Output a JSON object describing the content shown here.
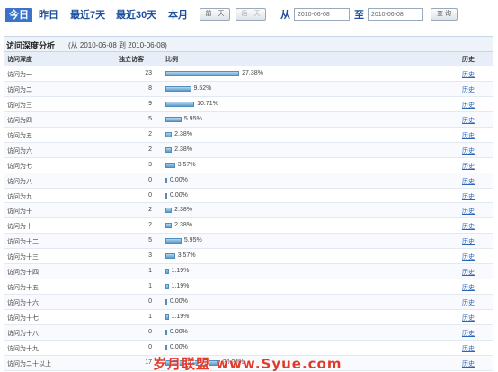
{
  "toolbar": {
    "tabs": [
      "今日",
      "昨日",
      "最近7天",
      "最近30天",
      "本月"
    ],
    "prev_label": "前一天",
    "next_label": "后一天",
    "from_label": "从",
    "from_value": "2010-06-08",
    "to_label": "至",
    "to_value": "2010-06-08",
    "query_label": "查 询"
  },
  "section": {
    "title": "访问深度分析",
    "range": "(从 2010-06-08 到 2010-06-08)"
  },
  "table": {
    "headers": {
      "depth": "访问深度",
      "count": "独立访客",
      "ratio": "比例",
      "history": "历史"
    },
    "rows": [
      {
        "name": "访问为一",
        "count": "23",
        "pct_label": "27.38%",
        "pct": 27.38,
        "history": "历史"
      },
      {
        "name": "访问为二",
        "count": "8",
        "pct_label": "9.52%",
        "pct": 9.52,
        "history": "历史"
      },
      {
        "name": "访问为三",
        "count": "9",
        "pct_label": "10.71%",
        "pct": 10.71,
        "history": "历史"
      },
      {
        "name": "访问为四",
        "count": "5",
        "pct_label": "5.95%",
        "pct": 5.95,
        "history": "历史"
      },
      {
        "name": "访问为五",
        "count": "2",
        "pct_label": "2.38%",
        "pct": 2.38,
        "history": "历史"
      },
      {
        "name": "访问为六",
        "count": "2",
        "pct_label": "2.38%",
        "pct": 2.38,
        "history": "历史"
      },
      {
        "name": "访问为七",
        "count": "3",
        "pct_label": "3.57%",
        "pct": 3.57,
        "history": "历史"
      },
      {
        "name": "访问为八",
        "count": "0",
        "pct_label": "0.00%",
        "pct": 0,
        "history": "历史"
      },
      {
        "name": "访问为九",
        "count": "0",
        "pct_label": "0.00%",
        "pct": 0,
        "history": "历史"
      },
      {
        "name": "访问为十",
        "count": "2",
        "pct_label": "2.38%",
        "pct": 2.38,
        "history": "历史"
      },
      {
        "name": "访问为十一",
        "count": "2",
        "pct_label": "2.38%",
        "pct": 2.38,
        "history": "历史"
      },
      {
        "name": "访问为十二",
        "count": "5",
        "pct_label": "5.95%",
        "pct": 5.95,
        "history": "历史"
      },
      {
        "name": "访问为十三",
        "count": "3",
        "pct_label": "3.57%",
        "pct": 3.57,
        "history": "历史"
      },
      {
        "name": "访问为十四",
        "count": "1",
        "pct_label": "1.19%",
        "pct": 1.19,
        "history": "历史"
      },
      {
        "name": "访问为十五",
        "count": "1",
        "pct_label": "1.19%",
        "pct": 1.19,
        "history": "历史"
      },
      {
        "name": "访问为十六",
        "count": "0",
        "pct_label": "0.00%",
        "pct": 0,
        "history": "历史"
      },
      {
        "name": "访问为十七",
        "count": "1",
        "pct_label": "1.19%",
        "pct": 1.19,
        "history": "历史"
      },
      {
        "name": "访问为十八",
        "count": "0",
        "pct_label": "0.00%",
        "pct": 0,
        "history": "历史"
      },
      {
        "name": "访问为十九",
        "count": "0",
        "pct_label": "0.00%",
        "pct": 0,
        "history": "历史"
      },
      {
        "name": "访问为二十以上",
        "count": "17",
        "pct_label": "20.24%",
        "pct": 20.24,
        "history": "历史"
      }
    ]
  },
  "watermark": "岁月联盟 www.Syue.com",
  "colors": {
    "accent": "#1d4f9c",
    "active_tab": "#3a73c7",
    "bar": "#5a9ccb",
    "link": "#2a63b8",
    "watermark": "#e23a2a"
  }
}
